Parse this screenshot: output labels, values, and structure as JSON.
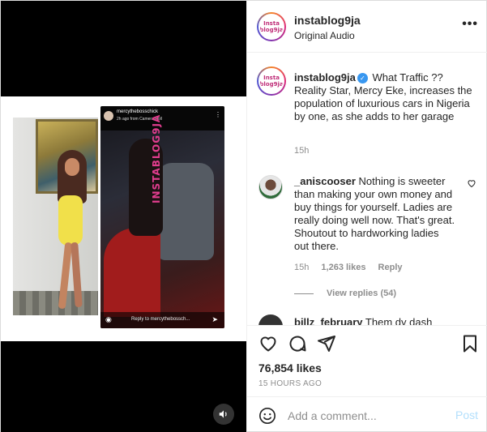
{
  "post": {
    "username": "instablog9ja",
    "audio": "Original Audio",
    "more_glyph": "•••",
    "avatar_logo": "Insta blog9ja"
  },
  "media": {
    "story": {
      "username": "mercythebosschick",
      "meta": "2h ago from Camera Roll",
      "reply_placeholder": "Reply to mercythebossch...",
      "watermark": "INSTABLOG9JA"
    }
  },
  "caption": {
    "username": "instablog9ja",
    "text": "What Traffic ?? Reality Star, Mercy Eke, increases the population of luxurious cars in Nigeria by one, as she adds to her garage",
    "time": "15h"
  },
  "comments": [
    {
      "username": "_aniscooser",
      "text": "Nothing is sweeter than making your own money and buy things for yourself. Ladies are really doing well now. That's great. Shoutout to hardworking ladies out there.",
      "time": "15h",
      "likes": "1,263 likes",
      "reply_label": "Reply",
      "view_replies": "View replies (54)"
    },
    {
      "username": "billz_february",
      "text": "Them dy dash"
    }
  ],
  "actions": {
    "likes": "76,854 likes",
    "timestamp": "15 HOURS AGO"
  },
  "add_comment": {
    "placeholder": "Add a comment...",
    "post_label": "Post"
  },
  "colors": {
    "verified": "#3897f0",
    "post_button_disabled": "#b2dffc",
    "muted_text": "#8e8e8e"
  }
}
